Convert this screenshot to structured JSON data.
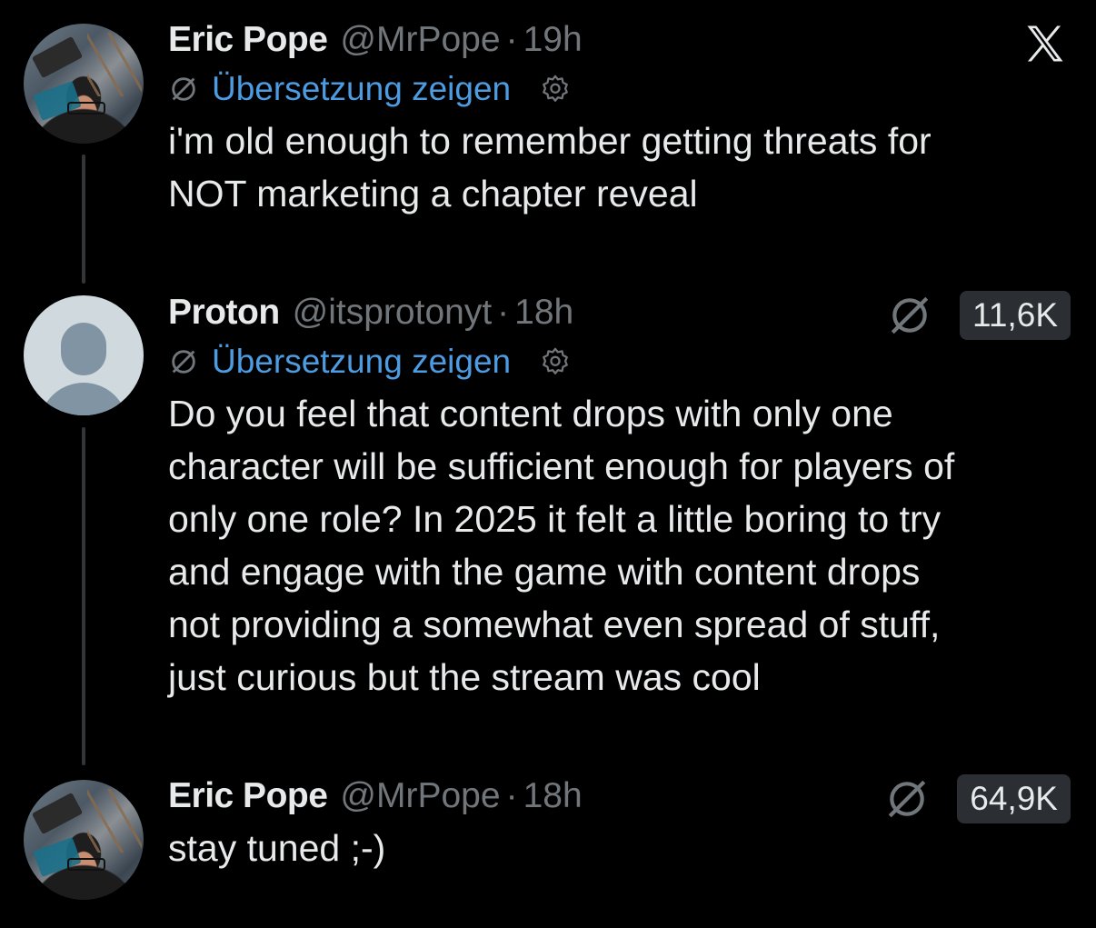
{
  "tweets": [
    {
      "name": "Eric Pope",
      "handle": "@MrPope",
      "separator": "·",
      "time": "19h",
      "translate_label": "Übersetzung zeigen",
      "text_lines": [
        "i'm old enough to remember getting threats for",
        "NOT marketing a chapter reveal"
      ]
    },
    {
      "name": "Proton",
      "handle": "@itsprotonyt",
      "separator": "·",
      "time": "18h",
      "translate_label": "Übersetzung zeigen",
      "view_count": "11,6K",
      "text_lines": [
        "Do you feel that content drops with only one",
        "character will be sufficient enough for players of",
        "only one role? In 2025 it felt a little boring to try",
        "and engage with the game with content drops",
        "not providing a somewhat even spread of stuff,",
        "just curious but the stream was cool"
      ]
    },
    {
      "name": "Eric Pope",
      "handle": "@MrPope",
      "separator": "·",
      "time": "18h",
      "view_count": "64,9K",
      "text_lines": [
        "stay tuned ;-)"
      ]
    }
  ],
  "icons": {
    "logo": "x-logo",
    "translate": "no-translate-icon",
    "settings": "gear-icon",
    "views": "no-views-icon"
  },
  "colors": {
    "background": "#000000",
    "text": "#e7e9ea",
    "secondary": "#71767b",
    "link": "#4d9be0",
    "badge": "#2b2e32"
  }
}
